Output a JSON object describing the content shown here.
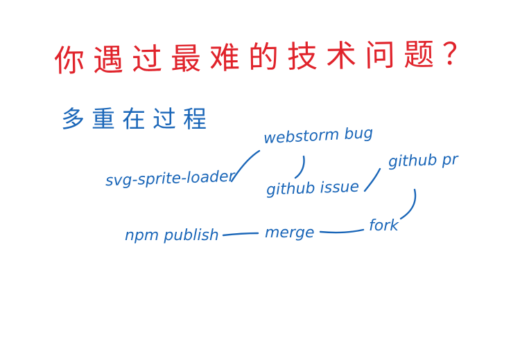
{
  "title": "你遇过最难的技术问题？",
  "subtitle": "多重在过程",
  "notes": {
    "webstorm_bug": "webstorm bug",
    "svg_sprite_loader": "svg-sprite-loader",
    "github_issue": "github issue",
    "github_pr": "github pr",
    "npm_publish": "npm publish",
    "merge": "merge",
    "fork": "fork"
  },
  "colors": {
    "title": "#e0232b",
    "ink": "#1a66b8",
    "background": "#ffffff"
  }
}
